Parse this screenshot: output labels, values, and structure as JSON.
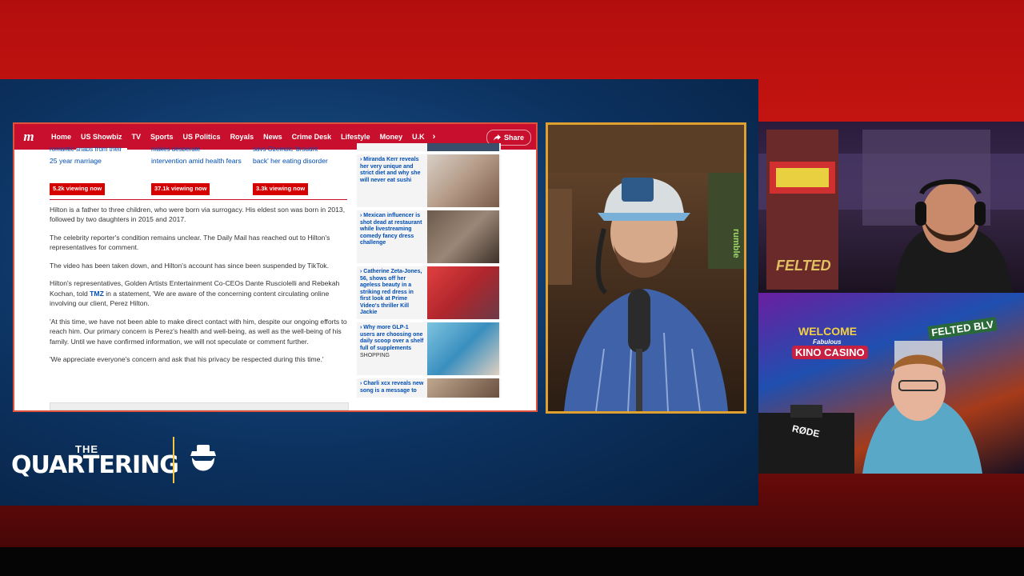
{
  "site": {
    "logo": "m",
    "nav": [
      "Home",
      "US Showbiz",
      "TV",
      "Sports",
      "US Politics",
      "Royals",
      "News",
      "Crime Desk",
      "Lifestyle",
      "Money",
      "U.K"
    ],
    "active_nav": "US Showbiz",
    "share_label": "Share"
  },
  "related": [
    {
      "cutoff": "romantic snaps from their",
      "title": "25 year marriage",
      "badge": "5.2k viewing now"
    },
    {
      "cutoff": "makes desperate",
      "title": "intervention amid health fears",
      "badge": "37.1k viewing now"
    },
    {
      "cutoff": "says Ozempic 'brought",
      "title": "back' her eating disorder",
      "badge": "3.3k viewing now"
    }
  ],
  "article": {
    "p1": "Hilton is a father to three children, who were born via surrogacy. His eldest son was born in 2013, followed by two daughters in 2015 and 2017.",
    "p2": "The celebrity reporter's condition remains unclear. The Daily Mail has reached out to Hilton's representatives for comment.",
    "p3": "The video has been taken down, and Hilton's account has since been suspended by TikTok.",
    "p4_a": "Hilton's representatives, Golden Artists Entertainment Co-CEOs Dante Rusciolelli and Rebekah Kochan, told ",
    "p4_link": "TMZ",
    "p4_b": " in a statement, 'We are aware of the concerning content circulating online involving our client, Perez Hilton.",
    "p5": "'At this time, we have not been able to make direct contact with him, despite our ongoing efforts to reach him. Our primary concern is Perez's health and well-being, as well as the well-being of his family. Until we have confirmed information, we will not speculate or comment further.",
    "p6": "'We appreciate everyone's concern and ask that his privacy be respected during this time.'"
  },
  "sidebar": [
    {
      "title": "Miranda Kerr reveals her very unique and strict diet and why she will never eat sushi",
      "tag": ""
    },
    {
      "title": "Mexican influencer is shot dead at restaurant while livestreaming comedy fancy dress challenge",
      "tag": ""
    },
    {
      "title": "Catherine Zeta-Jones, 56, shows off her ageless beauty in a striking red dress in first look at Prime Video's thriller Kill Jackie",
      "tag": ""
    },
    {
      "title": "Why more GLP-1 users are choosing one daily scoop over a shelf full of supplements",
      "tag": "SHOPPING"
    },
    {
      "title": "Charli xcx reveals new song is a message to",
      "tag": ""
    }
  ],
  "stream": {
    "brand_the": "THE",
    "brand_name": "QUARTERING",
    "cam_main_sign": "rumble",
    "cam_right_top_sign": "FELTED",
    "cam_right_bottom_sign1": "WELCOME",
    "cam_right_bottom_sign2": "Fabulous",
    "cam_right_bottom_sign3": "KINO CASINO",
    "cam_right_bottom_sign4": "FELTED BLV",
    "cam_right_bottom_mic": "RØDE"
  },
  "colors": {
    "nav_red": "#c8102e",
    "link_blue": "#004db3",
    "badge_red": "#d50000",
    "frame_orange": "#e0a030"
  }
}
